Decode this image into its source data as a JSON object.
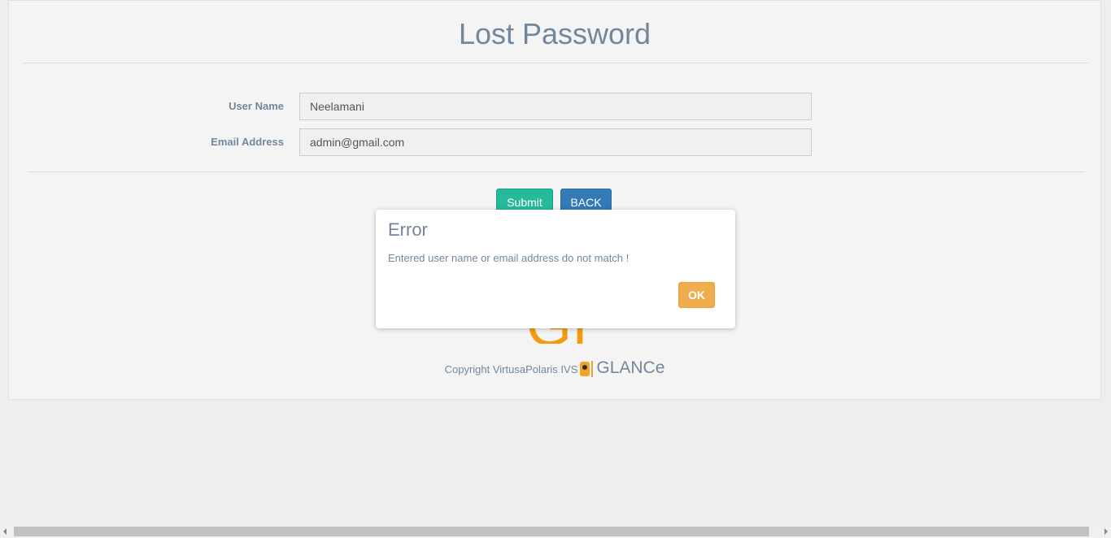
{
  "page": {
    "title": "Lost Password"
  },
  "form": {
    "username_label": "User Name",
    "username_value": "Neelamani",
    "email_label": "Email Address",
    "email_value": "admin@gmail.com",
    "submit_label": "Submit",
    "back_label": "BACK"
  },
  "footer": {
    "logo_fragment": "GI",
    "copyright_text": "Copyright VirtusaPolaris IVS",
    "brand_name": "GLANCe"
  },
  "modal": {
    "title": "Error",
    "message": "Entered user name or email address do not match !",
    "ok_label": "OK"
  },
  "colors": {
    "text": "#73879c",
    "submit": "#26b99a",
    "back": "#337ab7",
    "ok": "#f0ad4e",
    "logo": "#f39c12"
  }
}
